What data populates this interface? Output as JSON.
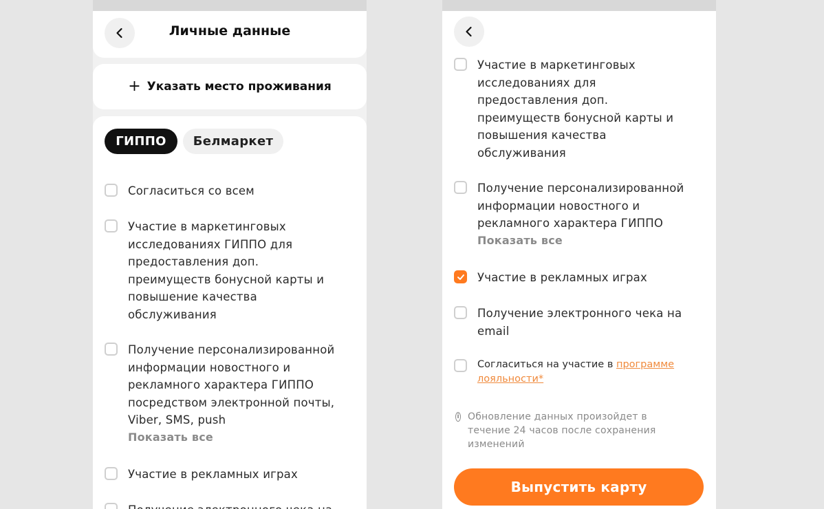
{
  "left": {
    "header": {
      "title": "Личные данные",
      "back_icon": "chevron-left-icon"
    },
    "address": {
      "plus": "+",
      "label": "Указать место проживания"
    },
    "tabs": [
      {
        "label": "ГИППО",
        "active": true
      },
      {
        "label": "Белмаркет",
        "active": false
      }
    ],
    "consents": [
      {
        "text": "Согласиться со всем",
        "checked": false
      },
      {
        "text": "Участие в маркетинговых исследованиях ГИППО для предоставления доп. преимуществ бонусной карты и повышение качества обслуживания",
        "checked": false
      },
      {
        "text": "Получение персонализированной информации новостного и рекламного характера ГИППО посредством электронной почты, Viber, SMS, push",
        "checked": false,
        "show_all": "Показать все"
      },
      {
        "text": "Участие в рекламных играх",
        "checked": false
      },
      {
        "text": "Получение электронного чека на",
        "checked": false
      }
    ]
  },
  "right": {
    "header": {
      "back_icon": "chevron-left-icon"
    },
    "consents": [
      {
        "text": "Участие в маркетинговых исследованиях для предоставления доп. преимуществ бонусной карты и повышения качества обслуживания",
        "checked": false
      },
      {
        "text": "Получение персонализированной информации новостного и рекламного характера ГИППО",
        "checked": false,
        "show_all": "Показать все"
      },
      {
        "text": "Участие в рекламных играх",
        "checked": true
      },
      {
        "text": "Получение электронного чека на email",
        "checked": false
      },
      {
        "text_prefix": "Согласиться на участие в ",
        "link": "программе лояльности*",
        "checked": false
      }
    ],
    "info": {
      "icon": "info-icon",
      "text": "Обновление данных произойдет в течение 24 часов после сохранения изменений"
    },
    "cta": {
      "label": "Выпустить карту"
    }
  },
  "colors": {
    "accent": "#ff7a1f",
    "dark_chip": "#111111",
    "muted": "#8a8a8a"
  }
}
